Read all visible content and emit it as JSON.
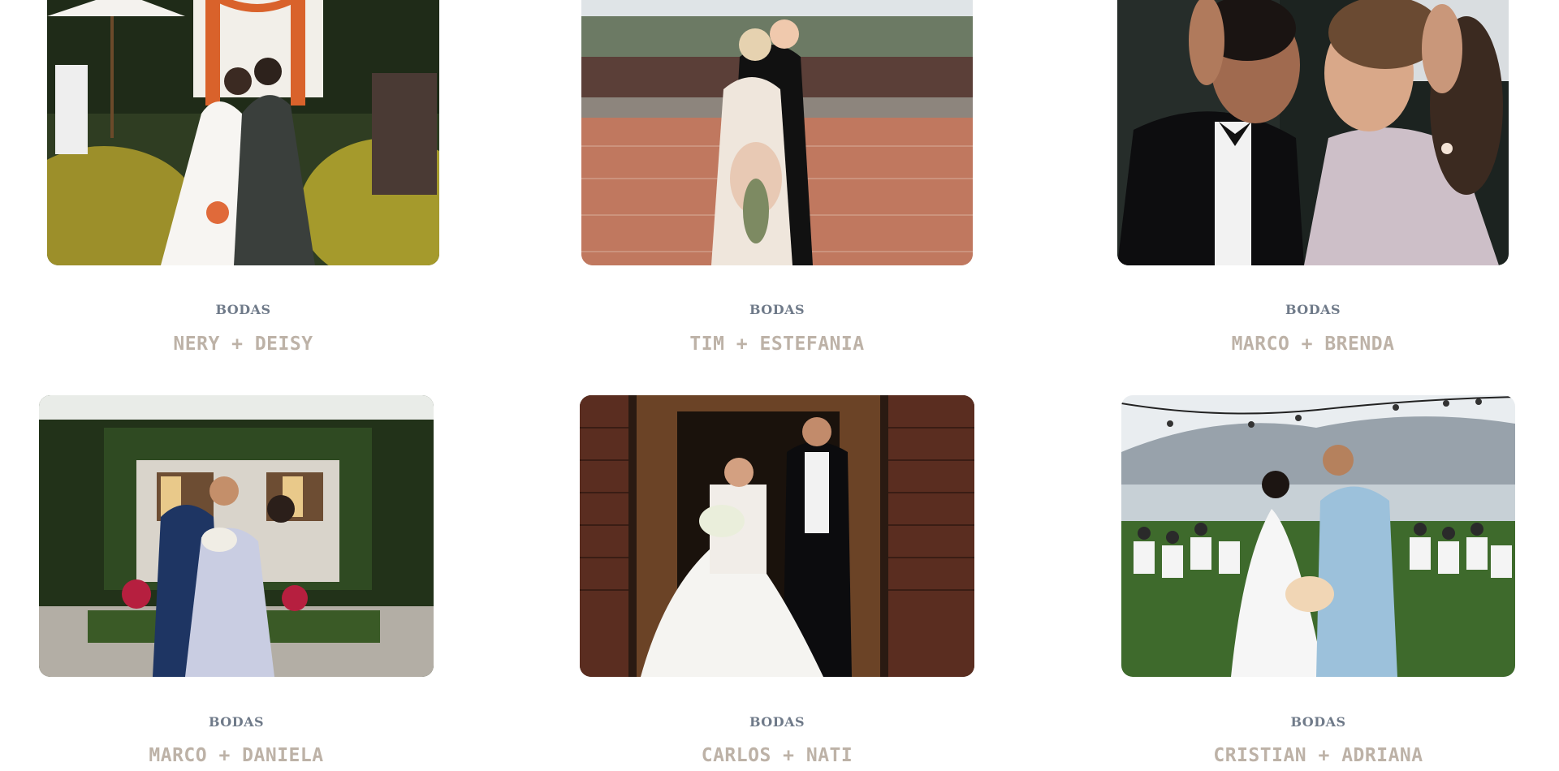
{
  "portfolio": {
    "items": [
      {
        "category": "BODAS",
        "title": "NERY + DEISY",
        "scene": "garden-ceremony-kiss"
      },
      {
        "category": "BODAS",
        "title": "TIM + ESTEFANIA",
        "scene": "plaza-embrace"
      },
      {
        "category": "BODAS",
        "title": "MARCO + BRENDA",
        "scene": "dance-closeup"
      },
      {
        "category": "BODAS",
        "title": "MARCO + DANIELA",
        "scene": "cottage-garden"
      },
      {
        "category": "BODAS",
        "title": "CARLOS + NATI",
        "scene": "wooden-door-portrait"
      },
      {
        "category": "BODAS",
        "title": "CRISTIAN + ADRIANA",
        "scene": "lakeside-aisle-kiss"
      }
    ]
  }
}
